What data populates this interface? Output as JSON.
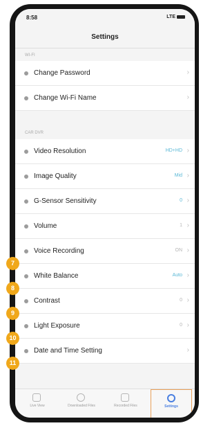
{
  "status": {
    "time": "8:58",
    "right": "LTE"
  },
  "navbar": {
    "title": "Settings"
  },
  "sections": {
    "wifi": "WI-FI",
    "car_dvr": "CAR DVR"
  },
  "rows": [
    {
      "label": "Change Password",
      "value": ""
    },
    {
      "label": "Change Wi-Fi Name",
      "value": ""
    },
    {
      "label": "Video Resolution",
      "value": "HD+HD"
    },
    {
      "label": "Image Quality",
      "value": "Mid"
    },
    {
      "label": "G-Sensor Sensitivity",
      "value": "0"
    },
    {
      "label": "Volume",
      "value": "1"
    },
    {
      "label": "Voice Recording",
      "value": "ON"
    },
    {
      "label": "White Balance",
      "value": "Auto"
    },
    {
      "label": "Contrast",
      "value": "0"
    },
    {
      "label": "Light Exposure",
      "value": "0"
    },
    {
      "label": "Date and Time Setting",
      "value": ""
    }
  ],
  "badges": [
    "7",
    "8",
    "9",
    "10",
    "11"
  ],
  "tabs": [
    {
      "label": "Live View",
      "icon": "camera-icon"
    },
    {
      "label": "Downloaded Files",
      "icon": "play-circle-icon"
    },
    {
      "label": "Recorded Files",
      "icon": "play-file-icon"
    },
    {
      "label": "Settings",
      "icon": "gear-icon"
    }
  ],
  "colors": {
    "accent": "#4a7fe0",
    "badge": "#f0a81b",
    "value": "#5ab8d6"
  }
}
